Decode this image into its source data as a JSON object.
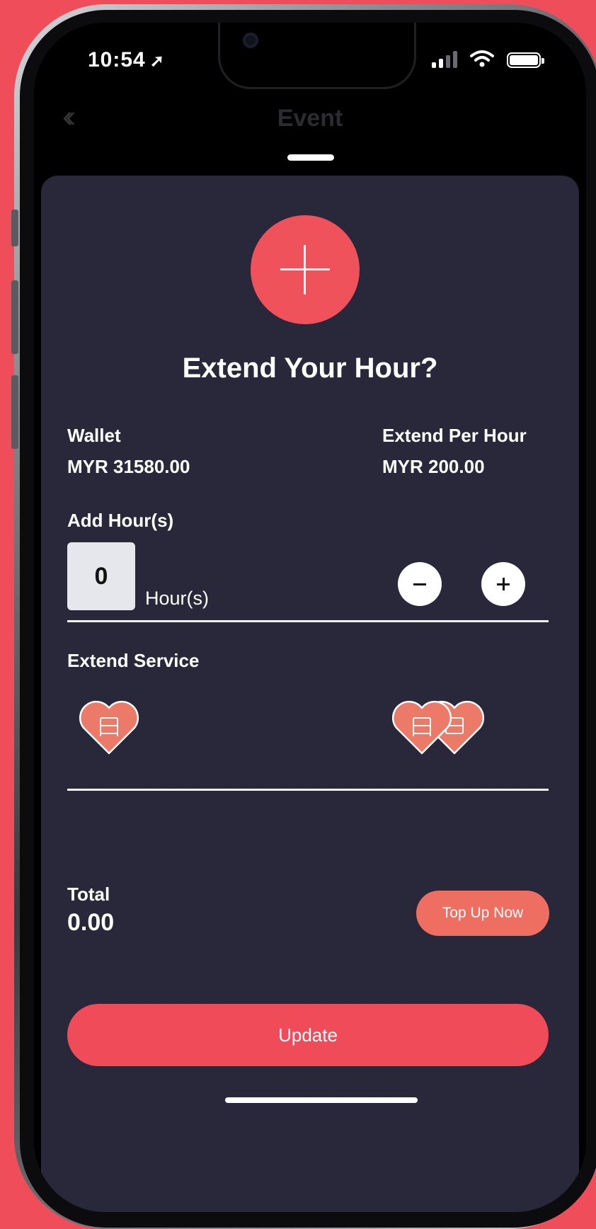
{
  "status_bar": {
    "time": "10:54"
  },
  "nav": {
    "title": "Event"
  },
  "dialog": {
    "title": "Extend Your Hour?",
    "wallet_label": "Wallet",
    "wallet_value": "MYR 31580.00",
    "rate_label": "Extend Per Hour",
    "rate_value": "MYR 200.00",
    "add_hours_label": "Add Hour(s)",
    "hours_value": "0",
    "hours_unit": "Hour(s)",
    "extend_service_label": "Extend Service",
    "total_label": "Total",
    "total_value": "0.00",
    "top_up_label": "Top Up Now",
    "update_label": "Update"
  },
  "colors": {
    "accent": "#f04d5b",
    "sheet_background": "#29283b",
    "heart": "#ec7a68"
  }
}
